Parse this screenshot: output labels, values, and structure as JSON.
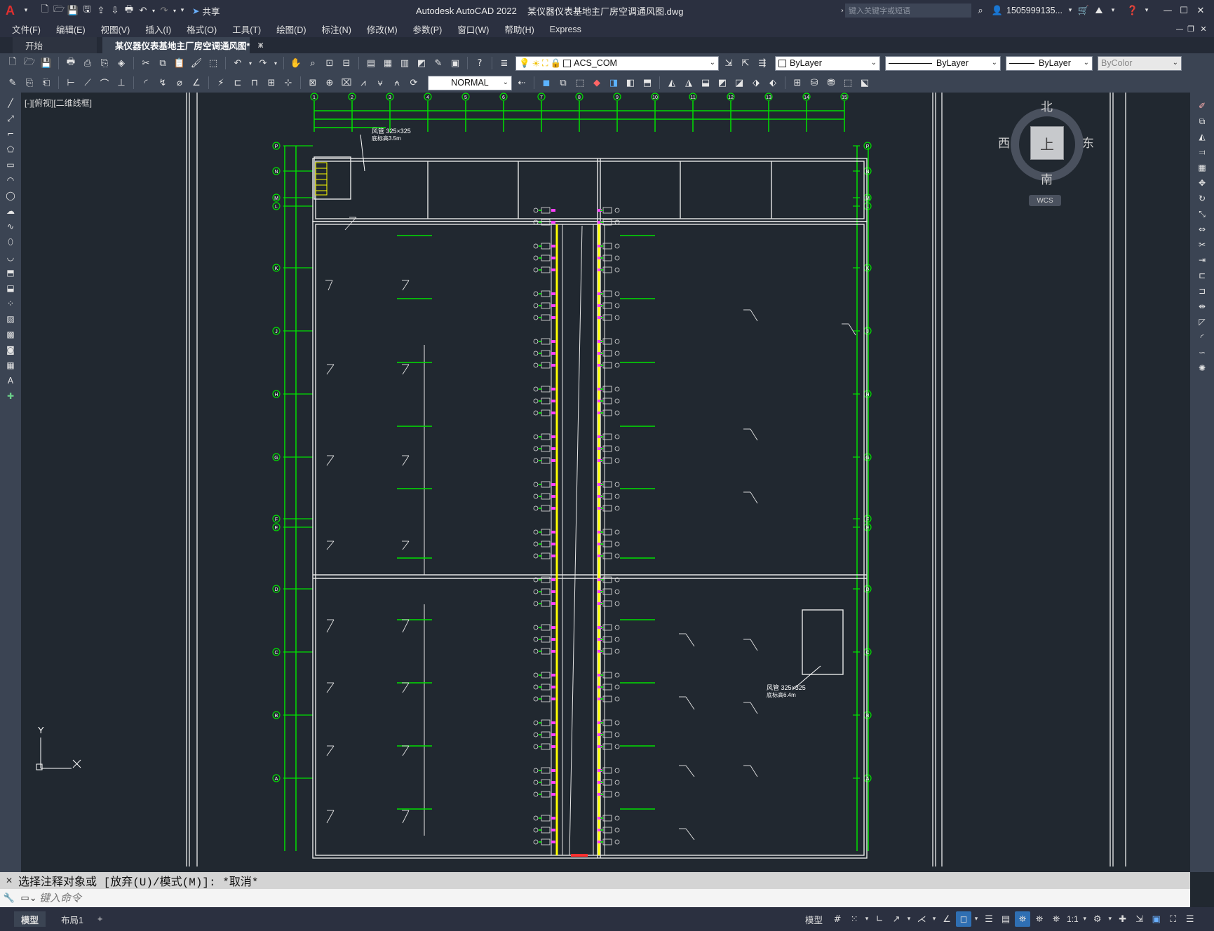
{
  "title_bar": {
    "app_title": "Autodesk AutoCAD 2022",
    "file_title": "某仪器仪表基地主厂房空调通风图.dwg",
    "share_label": "共享",
    "search_placeholder": "键入关键字或短语",
    "user_name": "1505999135..."
  },
  "menu": [
    "文件(F)",
    "编辑(E)",
    "视图(V)",
    "插入(I)",
    "格式(O)",
    "工具(T)",
    "绘图(D)",
    "标注(N)",
    "修改(M)",
    "参数(P)",
    "窗口(W)",
    "帮助(H)",
    "Express"
  ],
  "tabs": {
    "start": "开始",
    "drawing": "某仪器仪表基地主厂房空调通风图*",
    "close": "✕",
    "add": "+"
  },
  "toolbar": {
    "layer": "ACS_COM",
    "color": "ByLayer",
    "linetype": "ByLayer",
    "lineweight": "ByLayer",
    "plotstyle": "ByColor",
    "dimstyle": "NORMAL"
  },
  "viewport": {
    "label": "[-][俯视][二维线框]"
  },
  "viewcube": {
    "north": "北",
    "south": "南",
    "east": "东",
    "west": "西",
    "top": "上",
    "wcs": "WCS"
  },
  "ucs": {
    "y": "Y"
  },
  "drawing": {
    "grid_top": [
      "1",
      "2",
      "3",
      "4",
      "5",
      "6",
      "7",
      "8",
      "9",
      "10",
      "11",
      "12",
      "13",
      "14",
      "15"
    ],
    "grid_side": [
      "P",
      "N",
      "M",
      "L",
      "K",
      "J",
      "H",
      "G",
      "F",
      "E",
      "D",
      "C",
      "B",
      "A"
    ],
    "duct_note_top": "风管 325×325",
    "duct_note_top_2": "底标高3.5m",
    "duct_note_bottom": "风管 325×325",
    "duct_note_bottom_2": "底标高6.4m"
  },
  "command": {
    "history": "选择注释对象或 [放弃(U)/模式(M)]: *取消*",
    "placeholder": "键入命令"
  },
  "status": {
    "model_tabs": [
      "模型",
      "布局1"
    ],
    "add": "+",
    "model_label": "模型",
    "scale": "1:1"
  },
  "colors": {
    "accent": "#e02f2f",
    "grid_green": "#00e000",
    "duct_yellow": "#ffff00",
    "background": "#212830"
  }
}
